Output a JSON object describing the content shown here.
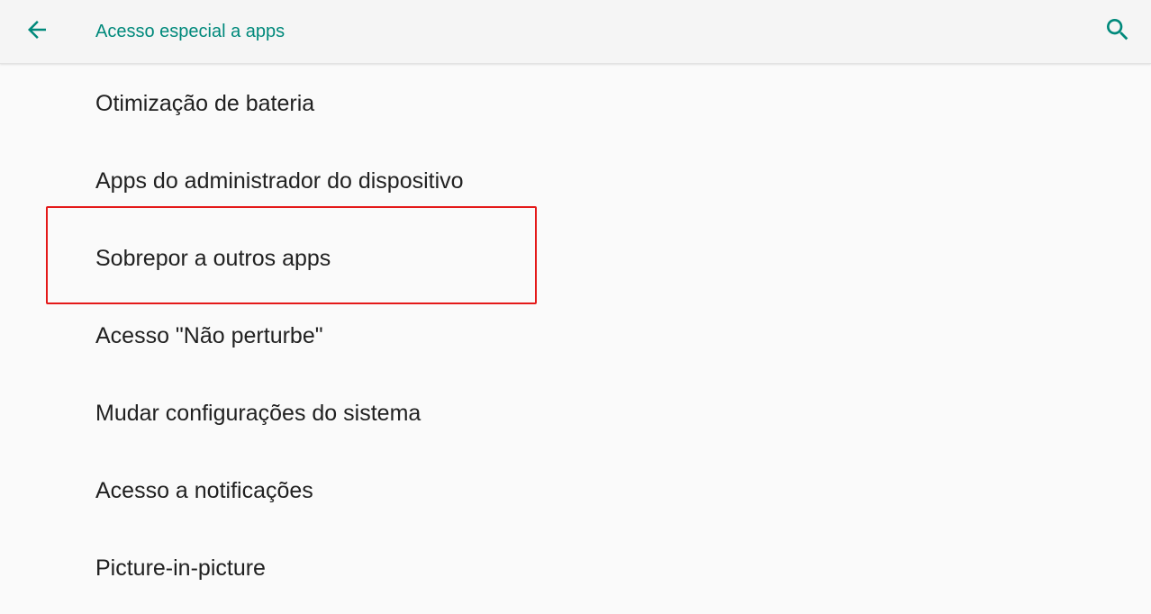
{
  "header": {
    "title": "Acesso especial a apps",
    "back_icon": "arrow-back-icon",
    "search_icon": "search-icon"
  },
  "colors": {
    "accent": "#00897b",
    "highlight_border": "#e41919",
    "text_primary": "#212121",
    "background": "#fafafa"
  },
  "list": {
    "items": [
      {
        "label": "Otimização de bateria"
      },
      {
        "label": "Apps do administrador do dispositivo"
      },
      {
        "label": "Sobrepor a outros apps"
      },
      {
        "label": "Acesso \"Não perturbe\""
      },
      {
        "label": "Mudar configurações do sistema"
      },
      {
        "label": "Acesso a notificações"
      },
      {
        "label": "Picture-in-picture"
      }
    ]
  }
}
